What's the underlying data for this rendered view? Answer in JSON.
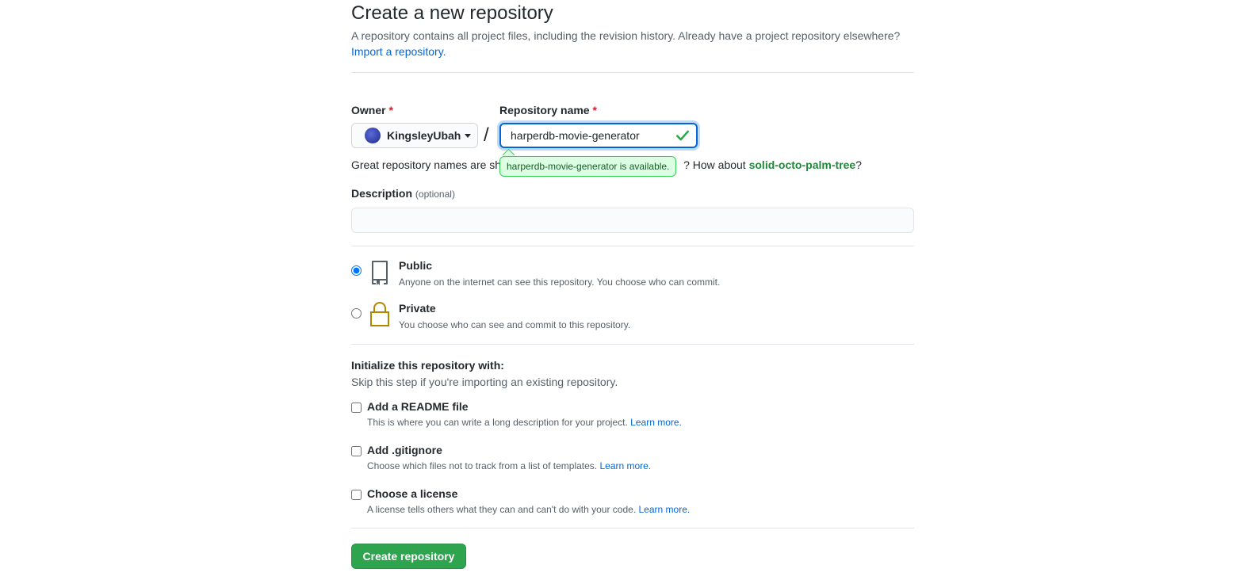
{
  "header": {
    "title": "Create a new repository",
    "subtitle": "A repository contains all project files, including the revision history. Already have a project repository elsewhere?",
    "import_link": "Import a repository."
  },
  "owner": {
    "label": "Owner",
    "required_mark": "*",
    "value": "KingsleyUbah"
  },
  "repo_name": {
    "label": "Repository name",
    "required_mark": "*",
    "value": "harperdb-movie-generator",
    "available_tooltip": "harperdb-movie-generator is available.",
    "hint_prefix": "Great repository names are sh",
    "hint_suffix": "? How about ",
    "suggestion": "solid-octo-palm-tree",
    "hint_end": "?"
  },
  "description": {
    "label": "Description",
    "optional": "(optional)",
    "value": ""
  },
  "visibility": {
    "public": {
      "title": "Public",
      "note": "Anyone on the internet can see this repository. You choose who can commit.",
      "selected": true
    },
    "private": {
      "title": "Private",
      "note": "You choose who can see and commit to this repository.",
      "selected": false
    }
  },
  "initialize": {
    "heading": "Initialize this repository with:",
    "subheading": "Skip this step if you're importing an existing repository.",
    "options": [
      {
        "title": "Add a README file",
        "note": "This is where you can write a long description for your project.",
        "link": "Learn more."
      },
      {
        "title": "Add .gitignore",
        "note": "Choose which files not to track from a list of templates.",
        "link": "Learn more."
      },
      {
        "title": "Choose a license",
        "note": "A license tells others what they can and can't do with your code.",
        "link": "Learn more."
      }
    ]
  },
  "submit": {
    "label": "Create repository"
  },
  "colors": {
    "primary_button": "#2ea44f",
    "link": "#0366d6",
    "success": "#22863a",
    "required": "#cb2431",
    "focus_border": "#0366d6"
  },
  "icons": {
    "public": "repo-book-icon",
    "private": "lock-icon",
    "valid": "check-icon",
    "owner_dropdown": "caret-down-icon"
  }
}
